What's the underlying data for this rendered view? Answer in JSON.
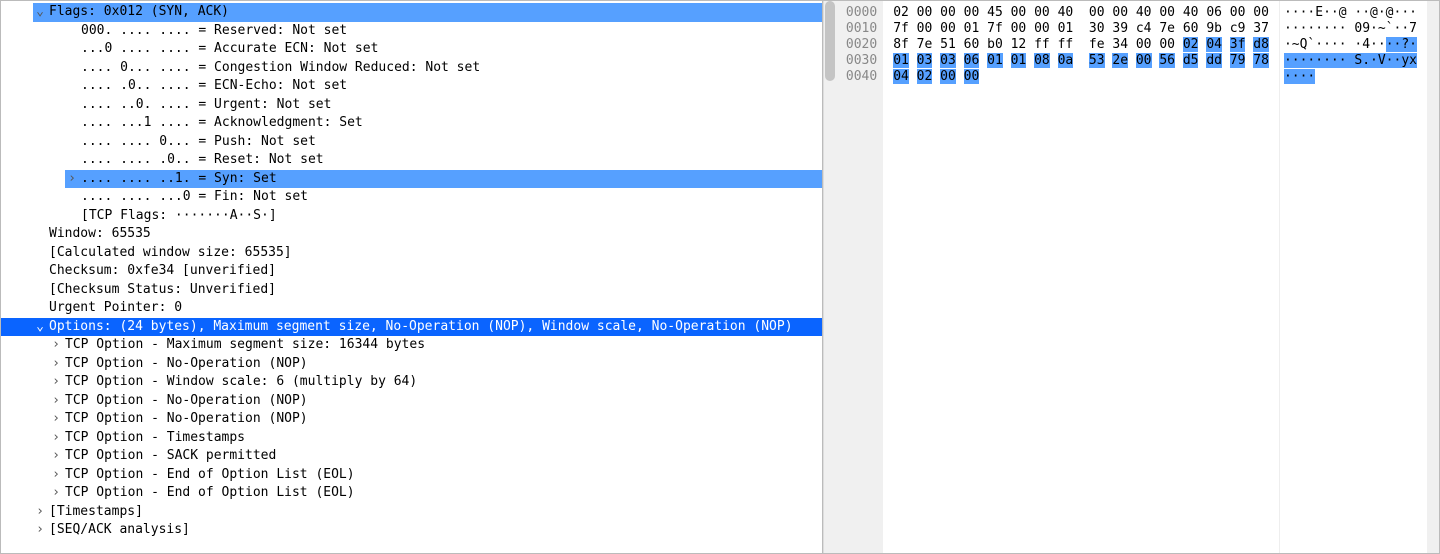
{
  "tree": [
    {
      "indent": 2,
      "arrow": "v",
      "hl": "blue",
      "text": "Flags: 0x012 (SYN, ACK)"
    },
    {
      "indent": 4,
      "arrow": "",
      "text": "000. .... .... = Reserved: Not set"
    },
    {
      "indent": 4,
      "arrow": "",
      "text": "...0 .... .... = Accurate ECN: Not set"
    },
    {
      "indent": 4,
      "arrow": "",
      "text": ".... 0... .... = Congestion Window Reduced: Not set"
    },
    {
      "indent": 4,
      "arrow": "",
      "text": ".... .0.. .... = ECN-Echo: Not set"
    },
    {
      "indent": 4,
      "arrow": "",
      "text": ".... ..0. .... = Urgent: Not set"
    },
    {
      "indent": 4,
      "arrow": "",
      "text": ".... ...1 .... = Acknowledgment: Set"
    },
    {
      "indent": 4,
      "arrow": "",
      "text": ".... .... 0... = Push: Not set"
    },
    {
      "indent": 4,
      "arrow": "",
      "text": ".... .... .0.. = Reset: Not set"
    },
    {
      "indent": 4,
      "arrow": ">",
      "hl": "blue",
      "text": ".... .... ..1. = Syn: Set"
    },
    {
      "indent": 4,
      "arrow": "",
      "text": ".... .... ...0 = Fin: Not set"
    },
    {
      "indent": 4,
      "arrow": "",
      "text": "[TCP Flags: ·······A··S·]"
    },
    {
      "indent": 2,
      "arrow": "",
      "text": "Window: 65535"
    },
    {
      "indent": 2,
      "arrow": "",
      "text": "[Calculated window size: 65535]"
    },
    {
      "indent": 2,
      "arrow": "",
      "text": "Checksum: 0xfe34 [unverified]"
    },
    {
      "indent": 2,
      "arrow": "",
      "text": "[Checksum Status: Unverified]"
    },
    {
      "indent": 2,
      "arrow": "",
      "text": "Urgent Pointer: 0"
    },
    {
      "indent": 2,
      "arrow": "v",
      "hl": "sel",
      "text": "Options: (24 bytes), Maximum segment size, No-Operation (NOP), Window scale, No-Operation (NOP)"
    },
    {
      "indent": 3,
      "arrow": ">",
      "text": "TCP Option - Maximum segment size: 16344 bytes"
    },
    {
      "indent": 3,
      "arrow": ">",
      "text": "TCP Option - No-Operation (NOP)"
    },
    {
      "indent": 3,
      "arrow": ">",
      "text": "TCP Option - Window scale: 6 (multiply by 64)"
    },
    {
      "indent": 3,
      "arrow": ">",
      "text": "TCP Option - No-Operation (NOP)"
    },
    {
      "indent": 3,
      "arrow": ">",
      "text": "TCP Option - No-Operation (NOP)"
    },
    {
      "indent": 3,
      "arrow": ">",
      "text": "TCP Option - Timestamps"
    },
    {
      "indent": 3,
      "arrow": ">",
      "text": "TCP Option - SACK permitted"
    },
    {
      "indent": 3,
      "arrow": ">",
      "text": "TCP Option - End of Option List (EOL)"
    },
    {
      "indent": 3,
      "arrow": ">",
      "text": "TCP Option - End of Option List (EOL)"
    },
    {
      "indent": 2,
      "arrow": ">",
      "text": "[Timestamps]"
    },
    {
      "indent": 2,
      "arrow": ">",
      "text": "[SEQ/ACK analysis]"
    }
  ],
  "hex": {
    "offsets": [
      "0000",
      "0010",
      "0020",
      "0030",
      "0040"
    ],
    "lines": [
      {
        "a": "02 00 00 00 45 00 00 40  00 00 40 00 40 06 00 00",
        "asc": "····E··@ ··@·@···",
        "hlStart": -1,
        "hlEnd": -1,
        "ascHl": [
          -1,
          -1
        ]
      },
      {
        "a": "7f 00 00 01 7f 00 00 01  30 39 c4 7e 60 9b c9 37",
        "asc": "········ 09·~`··7",
        "hlStart": -1,
        "hlEnd": -1,
        "ascHl": [
          -1,
          -1
        ]
      },
      {
        "a": "8f 7e 51 60 b0 12 ff ff  fe 34 00 00 02 04 3f d8",
        "asc": "·~Q`···· ·4····?·",
        "hlStart": 12,
        "hlEnd": 16,
        "ascHl": [
          13,
          17
        ]
      },
      {
        "a": "01 03 03 06 01 01 08 0a  53 2e 00 56 d5 dd 79 78",
        "asc": "········ S.·V··yx",
        "hlStart": 0,
        "hlEnd": 16,
        "ascHl": [
          0,
          17
        ]
      },
      {
        "a": "04 02 00 00",
        "asc": "····",
        "hlStart": 0,
        "hlEnd": 4,
        "ascHl": [
          0,
          4
        ]
      }
    ]
  }
}
